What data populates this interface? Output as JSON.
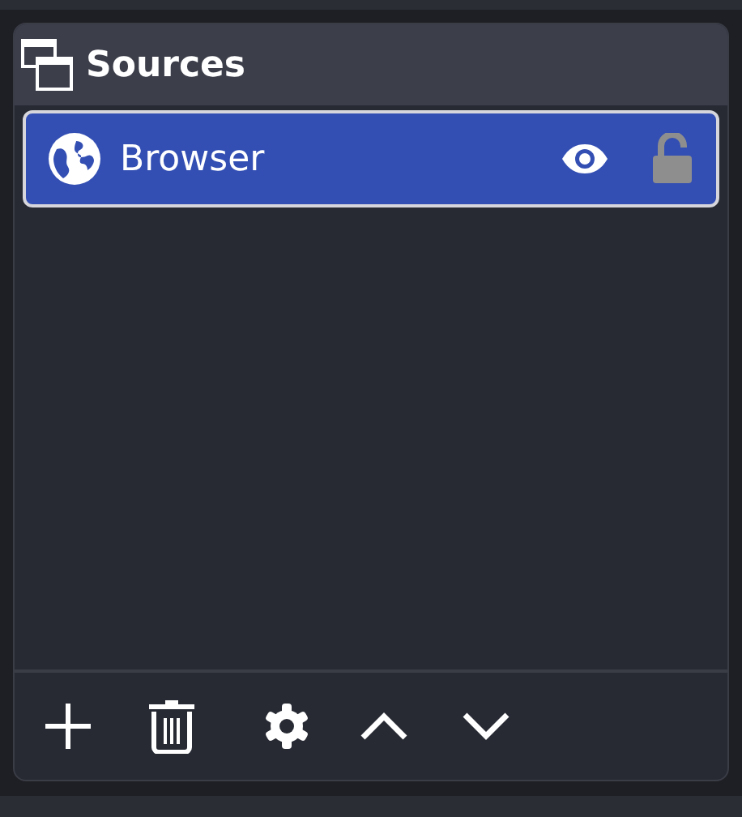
{
  "dock": {
    "title": "Sources"
  },
  "sources": [
    {
      "name": "Browser",
      "selected": true,
      "visible": true,
      "locked": false
    }
  ]
}
